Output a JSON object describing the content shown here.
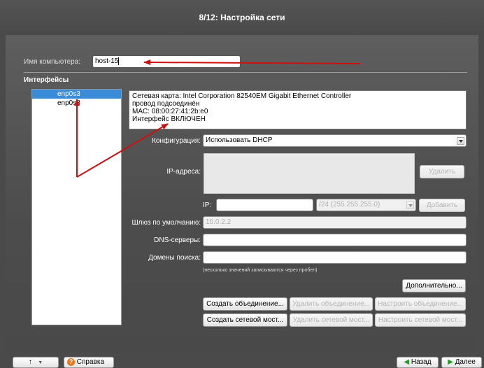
{
  "window": {
    "title": "8/12: Настройка сети"
  },
  "hostname": {
    "label": "Имя компьютера:",
    "value": "host-15"
  },
  "interfaces": {
    "section_label": "Интерфейсы",
    "items": [
      {
        "name": "enp0s3",
        "selected": true
      },
      {
        "name": "enp0s8",
        "selected": false
      }
    ]
  },
  "info": {
    "lines": [
      "Сетевая карта: Intel Corporation 82540EM Gigabit Ethernet Controller",
      "провод подсоединён",
      "MAC: 08:00:27:41:2b:e0",
      "Интерфейс ВКЛЮЧЕН"
    ]
  },
  "config": {
    "label": "Конфигурация:",
    "value": "Использовать DHCP"
  },
  "ip_addresses": {
    "label": "IP-адреса:",
    "delete_button": "Удалить"
  },
  "ip_input": {
    "label": "IP:",
    "value": "",
    "mask_value": "/24 (255.255.255.0)",
    "add_button": "Добавить"
  },
  "gateway": {
    "label": "Шлюз по умолчанию:",
    "value": "10.0.2.2"
  },
  "dns": {
    "label": "DNS-серверы:",
    "value": ""
  },
  "search_domains": {
    "label": "Домены поиска:",
    "value": ""
  },
  "hint": "(несколько значений записываются через пробел)",
  "buttons": {
    "advanced": "Дополнительно...",
    "create_bond": "Создать объединение...",
    "delete_bond": "Удалить объединение...",
    "configure_bond": "Настроить объединение...",
    "create_bridge": "Создать сетевой мост...",
    "delete_bridge": "Удалить сетевой мост...",
    "configure_bridge": "Настроить сетевой мост..."
  },
  "footer": {
    "up_icon": "up-arrow-icon",
    "help_label": "Справка",
    "back_label": "Назад",
    "next_label": "Далее"
  },
  "colors": {
    "accent": "#3a8cd8",
    "annotation": "#cc1111"
  }
}
